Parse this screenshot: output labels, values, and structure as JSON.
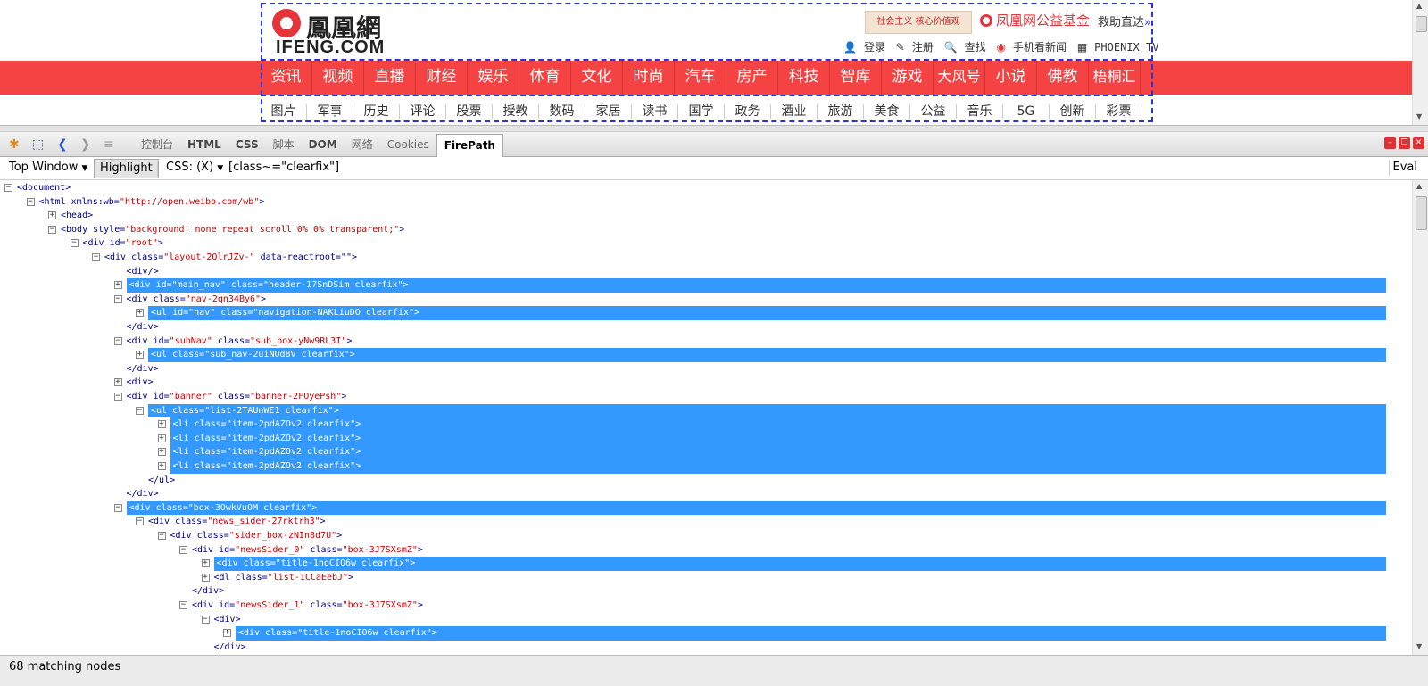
{
  "site": {
    "logo_cn": "鳳凰網",
    "logo_en": "IFENG.COM",
    "ad_text": "社会主义 核心价值观",
    "fund": "凤凰网公益基金",
    "rescue": "救助直达",
    "rescue_arrow": "»",
    "links": [
      "登录",
      "注册",
      "查找",
      "手机看新闻",
      "PHOENIX TV"
    ],
    "main_nav": [
      "资讯",
      "视频",
      "直播",
      "财经",
      "娱乐",
      "体育",
      "文化",
      "时尚",
      "汽车",
      "房产",
      "科技",
      "智库",
      "游戏",
      "大风号",
      "小说",
      "佛教",
      "梧桐汇"
    ],
    "sub_nav": [
      "图片",
      "军事",
      "历史",
      "评论",
      "股票",
      "授教",
      "数码",
      "家居",
      "读书",
      "国学",
      "政务",
      "酒业",
      "旅游",
      "美食",
      "公益",
      "音乐",
      "5G",
      "创新",
      "彩票"
    ]
  },
  "firebug": {
    "tabs": [
      "控制台",
      "HTML",
      "CSS",
      "脚本",
      "DOM",
      "网络",
      "Cookies",
      "FirePath"
    ],
    "active_tab": "FirePath",
    "window_select": "Top Window",
    "highlight_label": "Highlight",
    "css_label": "CSS: (X)",
    "query": "[class~=\"clearfix\"]",
    "eval_label": "Eval",
    "status": "68 matching nodes"
  },
  "tree": [
    {
      "d": 0,
      "t": "-",
      "hl": false,
      "parts": [
        [
          "tg",
          "<document>"
        ]
      ]
    },
    {
      "d": 1,
      "t": "-",
      "hl": false,
      "parts": [
        [
          "tg",
          "<html xmlns:wb="
        ],
        [
          "av",
          "\"http://open.weibo.com/wb\""
        ],
        [
          "tg",
          ">"
        ]
      ]
    },
    {
      "d": 2,
      "t": "+",
      "hl": false,
      "parts": [
        [
          "tg",
          "<head>"
        ]
      ]
    },
    {
      "d": 2,
      "t": "-",
      "hl": false,
      "parts": [
        [
          "tg",
          "<body style="
        ],
        [
          "av",
          "\"background: none repeat scroll 0% 0% transparent;\""
        ],
        [
          "tg",
          ">"
        ]
      ]
    },
    {
      "d": 3,
      "t": "-",
      "hl": false,
      "parts": [
        [
          "tg",
          "<div id="
        ],
        [
          "av",
          "\"root\""
        ],
        [
          "tg",
          ">"
        ]
      ]
    },
    {
      "d": 4,
      "t": "-",
      "hl": false,
      "parts": [
        [
          "tg",
          "<div class="
        ],
        [
          "av",
          "\"layout-2QlrJZv-\""
        ],
        [
          "tg",
          " data-reactroot=\"\">"
        ]
      ]
    },
    {
      "d": 5,
      "t": "",
      "hl": false,
      "parts": [
        [
          "tg",
          "<div/>"
        ]
      ]
    },
    {
      "d": 5,
      "t": "+",
      "hl": true,
      "parts": [
        [
          "tg",
          "<div id=\"main_nav\" class=\"header-17SnDSim clearfix\">"
        ]
      ]
    },
    {
      "d": 5,
      "t": "-",
      "hl": false,
      "parts": [
        [
          "tg",
          "<div class="
        ],
        [
          "av",
          "\"nav-2qn34By6\""
        ],
        [
          "tg",
          ">"
        ]
      ]
    },
    {
      "d": 6,
      "t": "+",
      "hl": true,
      "parts": [
        [
          "tg",
          "<ul id=\"nav\" class=\"navigation-NAKLiuDO clearfix\">"
        ]
      ]
    },
    {
      "d": 5,
      "t": "",
      "hl": false,
      "parts": [
        [
          "tg",
          "</div>"
        ]
      ]
    },
    {
      "d": 5,
      "t": "-",
      "hl": false,
      "parts": [
        [
          "tg",
          "<div id="
        ],
        [
          "av",
          "\"subNav\""
        ],
        [
          "tg",
          " class="
        ],
        [
          "av",
          "\"sub_box-yNw9RL3I\""
        ],
        [
          "tg",
          ">"
        ]
      ]
    },
    {
      "d": 6,
      "t": "+",
      "hl": true,
      "parts": [
        [
          "tg",
          "<ul class=\"sub_nav-2uiNOd8V clearfix\">"
        ]
      ]
    },
    {
      "d": 5,
      "t": "",
      "hl": false,
      "parts": [
        [
          "tg",
          "</div>"
        ]
      ]
    },
    {
      "d": 5,
      "t": "+",
      "hl": false,
      "parts": [
        [
          "tg",
          "<div>"
        ]
      ]
    },
    {
      "d": 5,
      "t": "-",
      "hl": false,
      "parts": [
        [
          "tg",
          "<div id="
        ],
        [
          "av",
          "\"banner\""
        ],
        [
          "tg",
          " class="
        ],
        [
          "av",
          "\"banner-2FOyePsh\""
        ],
        [
          "tg",
          ">"
        ]
      ]
    },
    {
      "d": 6,
      "t": "-",
      "hl": true,
      "parts": [
        [
          "tg",
          "<ul class=\"list-2TAUnWE1 clearfix\">"
        ]
      ]
    },
    {
      "d": 7,
      "t": "+",
      "hl": true,
      "parts": [
        [
          "tg",
          "<li class=\"item-2pdAZOv2 clearfix\">"
        ]
      ]
    },
    {
      "d": 7,
      "t": "+",
      "hl": true,
      "parts": [
        [
          "tg",
          "<li class=\"item-2pdAZOv2 clearfix\">"
        ]
      ]
    },
    {
      "d": 7,
      "t": "+",
      "hl": true,
      "parts": [
        [
          "tg",
          "<li class=\"item-2pdAZOv2 clearfix\">"
        ]
      ]
    },
    {
      "d": 7,
      "t": "+",
      "hl": true,
      "parts": [
        [
          "tg",
          "<li class=\"item-2pdAZOv2 clearfix\">"
        ]
      ]
    },
    {
      "d": 6,
      "t": "",
      "hl": false,
      "parts": [
        [
          "tg",
          "</ul>"
        ]
      ]
    },
    {
      "d": 5,
      "t": "",
      "hl": false,
      "parts": [
        [
          "tg",
          "</div>"
        ]
      ]
    },
    {
      "d": 5,
      "t": "-",
      "hl": true,
      "parts": [
        [
          "tg",
          "<div class=\"box-3OwkVuOM clearfix\">"
        ]
      ]
    },
    {
      "d": 6,
      "t": "-",
      "hl": false,
      "parts": [
        [
          "tg",
          "<div class="
        ],
        [
          "av",
          "\"news_sider-27rktrh3\""
        ],
        [
          "tg",
          ">"
        ]
      ]
    },
    {
      "d": 7,
      "t": "-",
      "hl": false,
      "parts": [
        [
          "tg",
          "<div class="
        ],
        [
          "av",
          "\"sider_box-zNIn8d7U\""
        ],
        [
          "tg",
          ">"
        ]
      ]
    },
    {
      "d": 8,
      "t": "-",
      "hl": false,
      "parts": [
        [
          "tg",
          "<div id="
        ],
        [
          "av",
          "\"newsSider_0\""
        ],
        [
          "tg",
          " class="
        ],
        [
          "av",
          "\"box-3J7SXsmZ\""
        ],
        [
          "tg",
          ">"
        ]
      ]
    },
    {
      "d": 9,
      "t": "+",
      "hl": true,
      "parts": [
        [
          "tg",
          "<div class=\"title-1noCIO6w clearfix\">"
        ]
      ]
    },
    {
      "d": 9,
      "t": "+",
      "hl": false,
      "parts": [
        [
          "tg",
          "<dl class="
        ],
        [
          "av",
          "\"list-1CCaEebJ\""
        ],
        [
          "tg",
          ">"
        ]
      ]
    },
    {
      "d": 8,
      "t": "",
      "hl": false,
      "parts": [
        [
          "tg",
          "</div>"
        ]
      ]
    },
    {
      "d": 8,
      "t": "-",
      "hl": false,
      "parts": [
        [
          "tg",
          "<div id="
        ],
        [
          "av",
          "\"newsSider_1\""
        ],
        [
          "tg",
          " class="
        ],
        [
          "av",
          "\"box-3J7SXsmZ\""
        ],
        [
          "tg",
          ">"
        ]
      ]
    },
    {
      "d": 9,
      "t": "-",
      "hl": false,
      "parts": [
        [
          "tg",
          "<div>"
        ]
      ]
    },
    {
      "d": 10,
      "t": "+",
      "hl": true,
      "parts": [
        [
          "tg",
          "<div class=\"title-1noCIO6w clearfix\">"
        ]
      ]
    },
    {
      "d": 9,
      "t": "",
      "hl": false,
      "parts": [
        [
          "tg",
          "</div>"
        ]
      ]
    }
  ]
}
